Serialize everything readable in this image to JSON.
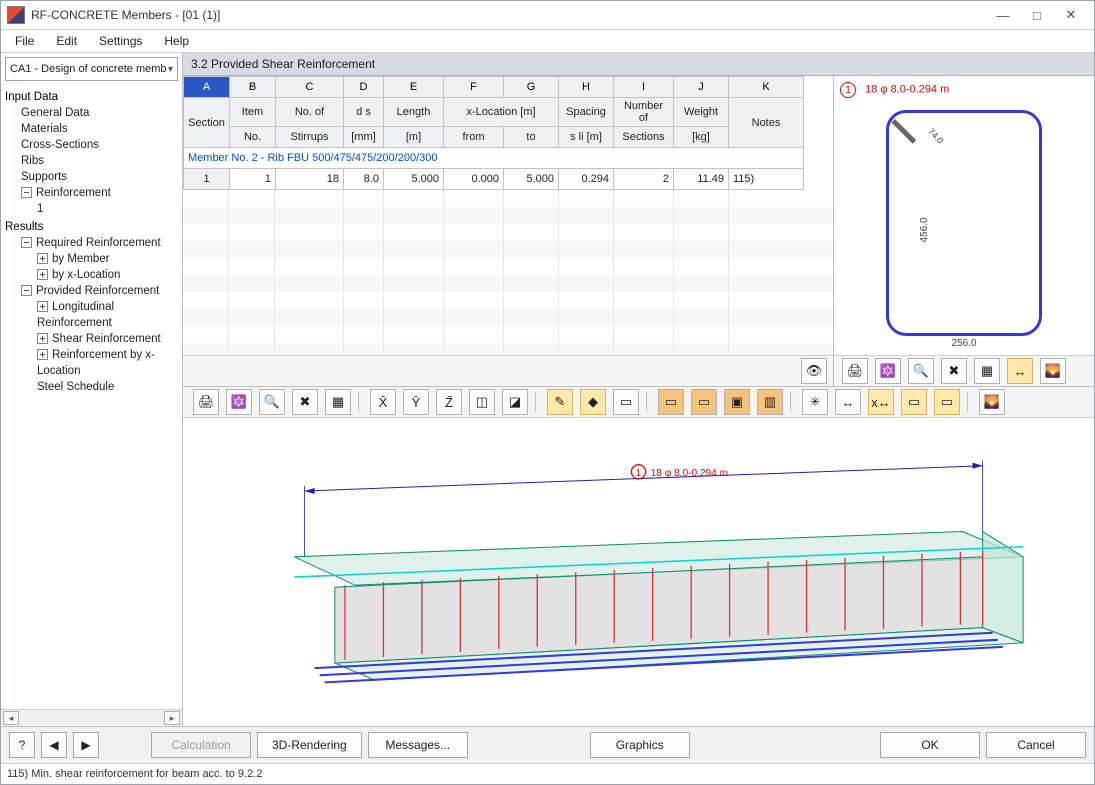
{
  "window": {
    "title": "RF-CONCRETE Members - [01 (1)]"
  },
  "menus": {
    "file": "File",
    "edit": "Edit",
    "settings": "Settings",
    "help": "Help"
  },
  "case_selector": "CA1 - Design of concrete memb",
  "tree": {
    "input_data": "Input Data",
    "general_data": "General Data",
    "materials": "Materials",
    "cross_sections": "Cross-Sections",
    "ribs": "Ribs",
    "supports": "Supports",
    "reinforcement": "Reinforcement",
    "reinforcement_1": "1",
    "results": "Results",
    "required_reinf": "Required Reinforcement",
    "by_member": "by Member",
    "by_xloc": "by x-Location",
    "provided_reinf": "Provided Reinforcement",
    "long_reinf": "Longitudinal Reinforcement",
    "shear_reinf": "Shear Reinforcement",
    "reinf_by_xloc": "Reinforcement by x-Location",
    "steel_schedule": "Steel Schedule"
  },
  "section_title": "3.2  Provided Shear Reinforcement",
  "table": {
    "cols": [
      "A",
      "B",
      "C",
      "D",
      "E",
      "F",
      "G",
      "H",
      "I",
      "J",
      "K"
    ],
    "headers1": {
      "A": "",
      "B": "Item",
      "C": "No. of",
      "D": "d s",
      "E": "Length",
      "FG": "x-Location [m]",
      "H": "Spacing",
      "I": "Number of",
      "J": "Weight",
      "K": ""
    },
    "headers2": {
      "A": "Section",
      "B": "No.",
      "C": "Stirrups",
      "D": "[mm]",
      "E": "[m]",
      "F": "from",
      "G": "to",
      "H": "s li [m]",
      "I": "Sections",
      "J": "[kg]",
      "K": "Notes"
    },
    "group_row": "Member No. 2  -  Rib FBU 500/475/475/200/200/300",
    "row": {
      "section": "1",
      "item": "1",
      "stirrups": "18",
      "ds": "8.0",
      "length": "5.000",
      "from": "0.000",
      "to": "5.000",
      "spacing": "0.294",
      "nsec": "2",
      "weight": "11.49",
      "notes": "115)"
    }
  },
  "cross_section": {
    "label": "18 φ 8.0-0.294 m",
    "height": "456.0",
    "width": "256.0",
    "diag": "74.0"
  },
  "render_label": "18 φ 8.0-0.294 m",
  "buttons": {
    "calculation": "Calculation",
    "rendering": "3D-Rendering",
    "messages": "Messages...",
    "graphics": "Graphics",
    "ok": "OK",
    "cancel": "Cancel"
  },
  "status": "115) Min. shear reinforcement for beam acc. to 9.2.2"
}
